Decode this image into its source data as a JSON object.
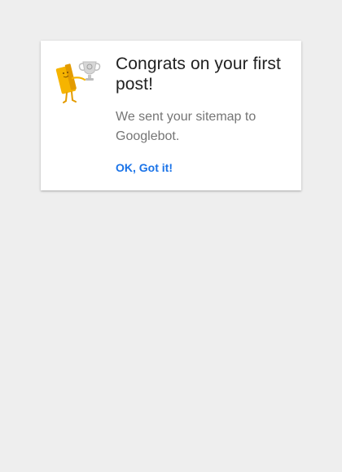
{
  "dialog": {
    "title": "Congrats on your first post!",
    "message": "We sent your sitemap to Googlebot.",
    "ok_label": "OK, Got it!",
    "illustration": "trophy-mascot-icon"
  },
  "colors": {
    "background": "#eeeeee",
    "card": "#ffffff",
    "title": "#212121",
    "message": "#757575",
    "accent": "#1a73e8",
    "mascot": "#f6b400",
    "trophy": "#cfcfcf"
  }
}
